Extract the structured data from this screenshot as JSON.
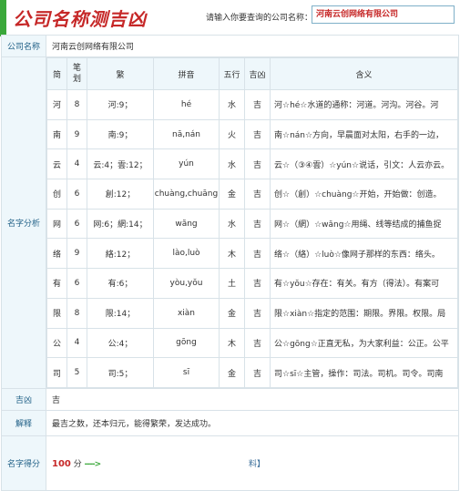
{
  "title": "公司名称测吉凶",
  "search": {
    "prompt": "请输入你要查询的公司名称：",
    "value": "河南云创网络有限公司"
  },
  "labels": {
    "company": "公司名称",
    "analysis": "名字分析",
    "luck": "吉凶",
    "explain": "解释",
    "score": "名字得分"
  },
  "company_name": "河南云创网络有限公司",
  "columns": [
    "简",
    "笔划",
    "繁",
    "拼音",
    "五行",
    "吉凶",
    "含义"
  ],
  "rows": [
    {
      "jian": "河",
      "strokes": "8",
      "fan": "河:9；",
      "pinyin": "hé",
      "wuxing": "水",
      "jixiong": "吉",
      "meaning": "河☆hé☆水道的通称：河道。河沟。河谷。河"
    },
    {
      "jian": "南",
      "strokes": "9",
      "fan": "南:9；",
      "pinyin": "nā,nán",
      "wuxing": "火",
      "jixiong": "吉",
      "meaning": "南☆nán☆方向，早晨面对太阳，右手的一边，"
    },
    {
      "jian": "云",
      "strokes": "4",
      "fan": "云:4；雲:12；",
      "pinyin": "yún",
      "wuxing": "水",
      "jixiong": "吉",
      "meaning": "云☆（③④雲）☆yún☆说话，引文：人云亦云。"
    },
    {
      "jian": "创",
      "strokes": "6",
      "fan": "創:12；",
      "pinyin": "chuàng,chuāng",
      "wuxing": "金",
      "jixiong": "吉",
      "meaning": "创☆（創）☆chuàng☆开始，开始做：创造。"
    },
    {
      "jian": "网",
      "strokes": "6",
      "fan": "网:6；網:14；",
      "pinyin": "wăng",
      "wuxing": "水",
      "jixiong": "吉",
      "meaning": "网☆（網）☆wăng☆用绳、线等结成的捕鱼捉"
    },
    {
      "jian": "络",
      "strokes": "9",
      "fan": "絡:12；",
      "pinyin": "lào,luò",
      "wuxing": "木",
      "jixiong": "吉",
      "meaning": "络☆（絡）☆luò☆像网子那样的东西：络头。"
    },
    {
      "jian": "有",
      "strokes": "6",
      "fan": "有:6；",
      "pinyin": "yòu,yŏu",
      "wuxing": "土",
      "jixiong": "吉",
      "meaning": "有☆yŏu☆存在：有关。有方（得法）。有案可"
    },
    {
      "jian": "限",
      "strokes": "8",
      "fan": "限:14；",
      "pinyin": "xiàn",
      "wuxing": "金",
      "jixiong": "吉",
      "meaning": "限☆xiàn☆指定的范围：期限。界限。权限。局"
    },
    {
      "jian": "公",
      "strokes": "4",
      "fan": "公:4；",
      "pinyin": "gōng",
      "wuxing": "木",
      "jixiong": "吉",
      "meaning": "公☆gōng☆正直无私，为大家利益：公正。公平"
    },
    {
      "jian": "司",
      "strokes": "5",
      "fan": "司:5；",
      "pinyin": "sī",
      "wuxing": "金",
      "jixiong": "吉",
      "meaning": "司☆sī☆主管，操作：司法。司机。司令。司南"
    }
  ],
  "luck_value": "吉",
  "explain_value": "最吉之数，还本归元，能得繁荣，发达成功。",
  "score": {
    "value": "100",
    "unit": "分",
    "arrow": "---->",
    "suffix": "料】"
  }
}
